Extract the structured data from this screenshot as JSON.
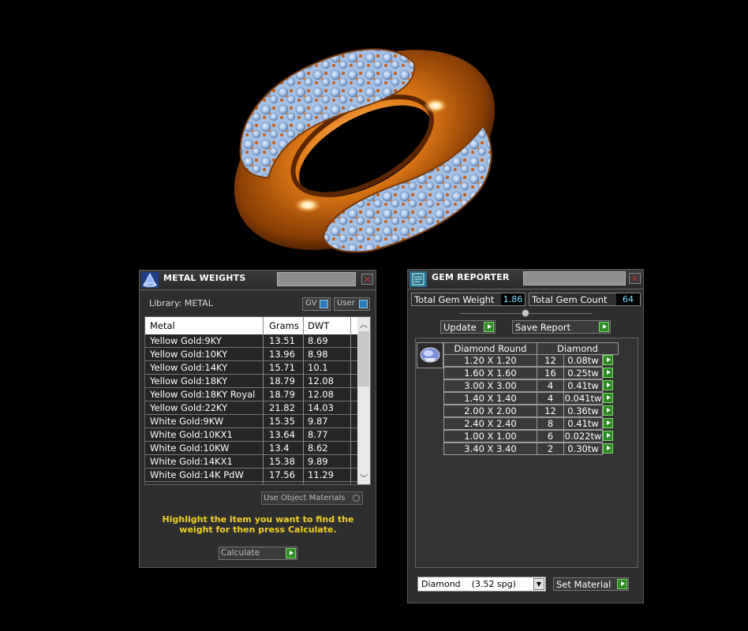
{
  "metal_weights": {
    "title": "METAL WEIGHTS",
    "library_label": "Library: METAL",
    "gv_label": "GV",
    "user_label": "User",
    "columns": [
      "Metal",
      "Grams",
      "DWT"
    ],
    "rows": [
      {
        "metal": "Yellow Gold:9KY",
        "grams": "13.51",
        "dwt": "8.69"
      },
      {
        "metal": "Yellow Gold:10KY",
        "grams": "13.96",
        "dwt": "8.98"
      },
      {
        "metal": "Yellow Gold:14KY",
        "grams": "15.71",
        "dwt": "10.1"
      },
      {
        "metal": "Yellow Gold:18KY",
        "grams": "18.79",
        "dwt": "12.08"
      },
      {
        "metal": "Yellow Gold:18KY Royal",
        "grams": "18.79",
        "dwt": "12.08"
      },
      {
        "metal": "Yellow Gold:22KY",
        "grams": "21.82",
        "dwt": "14.03"
      },
      {
        "metal": "White Gold:9KW",
        "grams": "15.35",
        "dwt": "9.87"
      },
      {
        "metal": "White Gold:10KX1",
        "grams": "13.64",
        "dwt": "8.77"
      },
      {
        "metal": "White Gold:10KW",
        "grams": "13.4",
        "dwt": "8.62"
      },
      {
        "metal": "White Gold:14KX1",
        "grams": "15.38",
        "dwt": "9.89"
      },
      {
        "metal": "White Gold:14K PdW",
        "grams": "17.56",
        "dwt": "11.29"
      }
    ],
    "use_object_materials": "Use Object Materials",
    "hint": "Highlight the item you want to find the weight for then press Calculate.",
    "calculate_label": "Calculate"
  },
  "gem_reporter": {
    "title": "GEM REPORTER",
    "total_weight_label": "Total Gem Weight",
    "total_weight_value": "1.86",
    "total_count_label": "Total Gem Count",
    "total_count_value": "64",
    "update_label": "Update",
    "save_report_label": "Save Report",
    "table_header_shape": "Diamond Round",
    "table_header_material": "Diamond",
    "gems": [
      {
        "size": "1.20 X 1.20",
        "count": "12",
        "weight": "0.08tw"
      },
      {
        "size": "1.60 X 1.60",
        "count": "16",
        "weight": "0.25tw"
      },
      {
        "size": "3.00 X 3.00",
        "count": "4",
        "weight": "0.41tw"
      },
      {
        "size": "1.40 X 1.40",
        "count": "4",
        "weight": "0.041tw"
      },
      {
        "size": "2.00 X 2.00",
        "count": "12",
        "weight": "0.36tw"
      },
      {
        "size": "2.40 X 2.40",
        "count": "8",
        "weight": "0.41tw"
      },
      {
        "size": "1.00 X 1.00",
        "count": "6",
        "weight": "0.022tw"
      },
      {
        "size": "3.40 X 3.40",
        "count": "2",
        "weight": "0.30tw"
      }
    ],
    "material_select": "Diamond    (3.52 spg)",
    "set_material_label": "Set Material"
  },
  "colors": {
    "ring_gold": "#d9700f",
    "gem_blue": "#a9c8ef",
    "accent_green": "#2e8a23",
    "hint_yellow": "#f2d21f",
    "value_cyan": "#7fe0ff"
  }
}
